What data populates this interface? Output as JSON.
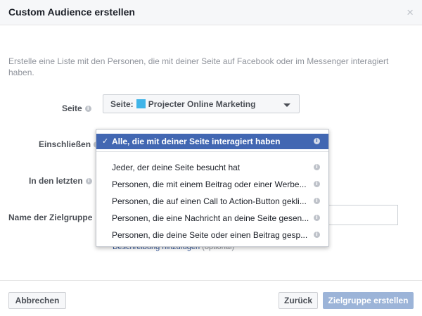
{
  "dialog": {
    "title": "Custom Audience erstellen",
    "close_glyph": "×",
    "description": "Erstelle eine Liste mit den Personen, die mit deiner Seite auf Facebook oder im Messenger interagiert haben."
  },
  "form": {
    "seite_label": "Seite",
    "seite_value": "Seite:",
    "seite_page_name": "Projecter Online Marketing",
    "einschliessen_label": "Einschließen",
    "in_den_letzten_label": "In den letzten",
    "name_label": "Name der Zielgruppe",
    "description_link": "Beschreibung hinzufügen",
    "description_optional": "(optional)",
    "info_glyph": "i"
  },
  "dropdown": {
    "selected_index": 0,
    "items": [
      {
        "label": "Alle, die mit deiner Seite interagiert haben"
      },
      {
        "label": "Jeder, der deine Seite besucht hat"
      },
      {
        "label": "Personen, die mit einem Beitrag oder einer Werbe..."
      },
      {
        "label": "Personen, die auf einen Call to Action-Button gekli..."
      },
      {
        "label": "Personen, die eine Nachricht an deine Seite gesen..."
      },
      {
        "label": "Personen, die deine Seite oder einen Beitrag gesp..."
      }
    ],
    "check_glyph": "✓"
  },
  "footer": {
    "cancel_label": "Abbrechen",
    "back_label": "Zurück",
    "create_label": "Zielgruppe erstellen"
  },
  "colors": {
    "accent": "#4267b2",
    "create_button_disabled": "#9cb4d8",
    "page_icon": "#3fb4e8"
  }
}
